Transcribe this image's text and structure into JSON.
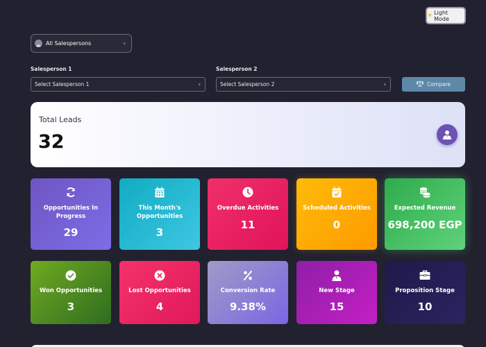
{
  "header": {
    "mode_label": "Light Mode"
  },
  "filter": {
    "label": "All Salespersons"
  },
  "compare": {
    "salesperson1_label": "Salesperson 1",
    "salesperson1_value": "Select Salesperson 1",
    "salesperson2_label": "Salesperson 2",
    "salesperson2_value": "Select Salesperson 2",
    "button_label": "Compare"
  },
  "total": {
    "title": "Total Leads",
    "value": "32"
  },
  "cards": [
    {
      "name": "Opportunities In Progress",
      "value": "29",
      "icon": "sync-icon",
      "colors": [
        "#6f55c3",
        "#7b6ee6"
      ]
    },
    {
      "name": "This Month's Opportunities",
      "value": "3",
      "icon": "calendar-icon",
      "colors": [
        "#11acc2",
        "#3ec7e2"
      ]
    },
    {
      "name": "Overdue Activities",
      "value": "11",
      "icon": "clock-icon",
      "colors": [
        "#f0306a",
        "#e0135a"
      ]
    },
    {
      "name": "Scheduled Activities",
      "value": "0",
      "icon": "calendar-check-icon",
      "colors": [
        "#fdbb08",
        "#ff9a00"
      ]
    },
    {
      "name": "Expected Revenue",
      "value": "698,200 EGP",
      "icon": "coins-icon",
      "colors": [
        "#2fab4c",
        "#5fd27b"
      ]
    },
    {
      "name": "Won Opportunities",
      "value": "3",
      "icon": "check-circle-icon",
      "colors": [
        "#6faa22",
        "#2f6c1f"
      ]
    },
    {
      "name": "Lost Opportunities",
      "value": "4",
      "icon": "times-circle-icon",
      "colors": [
        "#f5326b",
        "#e0195a"
      ]
    },
    {
      "name": "Conversion Rate",
      "value": "9.38%",
      "icon": "percent-icon",
      "colors": [
        "#9e9cc6",
        "#7b66e3"
      ]
    },
    {
      "name": "New Stage",
      "value": "15",
      "icon": "user-tie-icon",
      "colors": [
        "#8e1fa6",
        "#c41fc4"
      ]
    },
    {
      "name": "Proposition Stage",
      "value": "10",
      "icon": "briefcase-icon",
      "colors": [
        "#1e1a4a",
        "#2a2460"
      ]
    }
  ]
}
